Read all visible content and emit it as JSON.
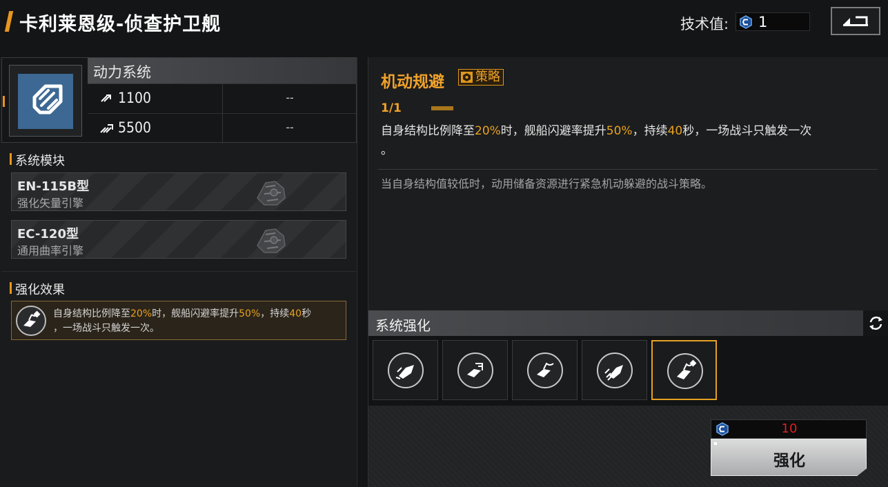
{
  "header": {
    "title": "卡利莱恩级-侦查护卫舰",
    "tech_label": "技术值:",
    "tech_value": "1",
    "back_icon": "return-icon"
  },
  "system": {
    "name": "动力系统",
    "icon": "engine-arrow-icon",
    "stats": [
      {
        "icon": "speed-icon",
        "value": "1100",
        "extra": "--"
      },
      {
        "icon": "warp-speed-icon",
        "value": "5500",
        "extra": "--"
      }
    ]
  },
  "modules": {
    "header": "系统模块",
    "items": [
      {
        "title": "EN-115B型",
        "subtitle": "强化矢量引擎"
      },
      {
        "title": "EC-120型",
        "subtitle": "通用曲率引擎"
      }
    ]
  },
  "effect": {
    "header": "强化效果",
    "icon": "evasion-ship-icon",
    "parts": [
      "自身结构比例降至",
      "20%",
      "时，舰船闪避率提升",
      "50%",
      "，持续",
      "40",
      "秒",
      "，一场战斗只触发一次。"
    ]
  },
  "skill": {
    "title": "机动规避",
    "badge": "策略",
    "level": "1/1",
    "desc_parts": [
      "自身结构比例降至",
      "20%",
      "时，舰船闪避率提升",
      "50%",
      "，持续",
      "40",
      "秒，一场战斗只触发一次",
      "。"
    ],
    "flavor": "当自身结构值较低时，动用储备资源进行紧急机动躲避的战斗策略。"
  },
  "enhance": {
    "header": "系统强化",
    "refresh_icon": "refresh-icon",
    "slots": [
      {
        "icon": "ship-speed-icon",
        "selected": false
      },
      {
        "icon": "ship-boost-icon",
        "selected": false
      },
      {
        "icon": "ship-turn-icon",
        "selected": false
      },
      {
        "icon": "ship-dash-icon",
        "selected": false
      },
      {
        "icon": "ship-evade-icon",
        "selected": true
      }
    ],
    "cost": "10",
    "cost_icon": "tech-point-icon",
    "button_label": "强化"
  },
  "colors": {
    "accent": "#e8961f",
    "highlight": "#e8a21f",
    "cost": "#e02020",
    "system_icon_bg": "#3d6893"
  }
}
